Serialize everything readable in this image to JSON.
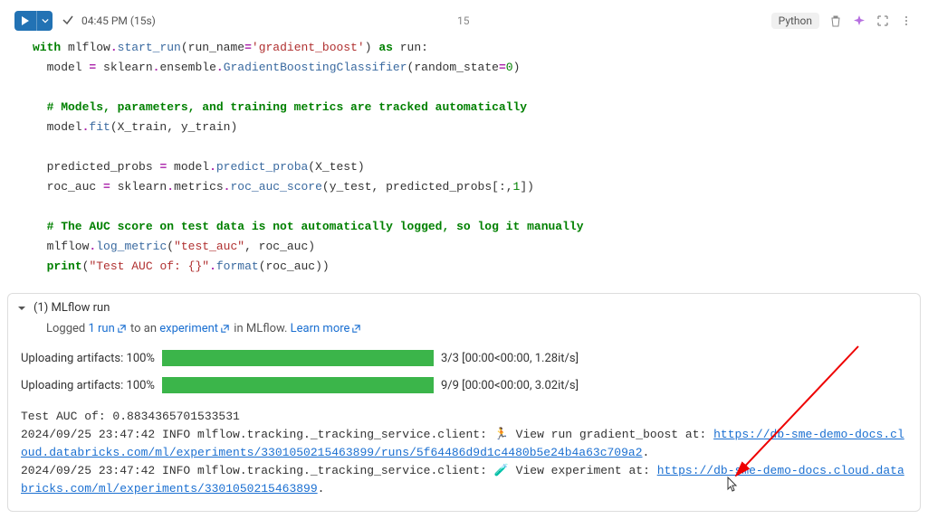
{
  "header": {
    "time": "04:45 PM (15s)",
    "cell_num": "15",
    "lang": "Python"
  },
  "code": {
    "l1a": "with",
    "l1b": " mlflow",
    "l1c": ".",
    "l1d": "start_run",
    "l1e": "(run_name",
    "l1f": "=",
    "l1g": "'gradient_boost'",
    "l1h": ") ",
    "l1i": "as",
    "l1j": " run:",
    "l2a": "  model ",
    "l2b": "=",
    "l2c": " sklearn",
    "l2d": ".",
    "l2e": "ensemble",
    "l2f": ".",
    "l2g": "GradientBoostingClassifier",
    "l2h": "(random_state",
    "l2i": "=",
    "l2j": "0",
    "l2k": ")",
    "l3": "  # Models, parameters, and training metrics are tracked automatically",
    "l4a": "  model",
    "l4b": ".",
    "l4c": "fit",
    "l4d": "(X_train, y_train)",
    "l5a": "  predicted_probs ",
    "l5b": "=",
    "l5c": " model",
    "l5d": ".",
    "l5e": "predict_proba",
    "l5f": "(X_test)",
    "l6a": "  roc_auc ",
    "l6b": "=",
    "l6c": " sklearn",
    "l6d": ".",
    "l6e": "metrics",
    "l6f": ".",
    "l6g": "roc_auc_score",
    "l6h": "(y_test, predicted_probs[:,",
    "l6i": "1",
    "l6j": "])",
    "l7": "  # The AUC score on test data is not automatically logged, so log it manually",
    "l8a": "  mlflow",
    "l8b": ".",
    "l8c": "log_metric",
    "l8d": "(",
    "l8e": "\"test_auc\"",
    "l8f": ", roc_auc)",
    "l9a": "  ",
    "l9b": "print",
    "l9c": "(",
    "l9d": "\"Test AUC of: {}\"",
    "l9e": ".",
    "l9f": "format",
    "l9g": "(roc_auc))"
  },
  "mlflow": {
    "title": "(1) MLflow run",
    "sub_prefix": "Logged ",
    "sub_link1": "1 run",
    "sub_mid1": " to an ",
    "sub_link2": "experiment",
    "sub_mid2": " in MLflow. ",
    "sub_link3": "Learn more"
  },
  "bars": [
    {
      "label": "Uploading artifacts: 100%",
      "stats": "3/3 [00:00<00:00, 1.28it/s]"
    },
    {
      "label": "Uploading artifacts: 100%",
      "stats": "9/9 [00:00<00:00, 3.02it/s]"
    }
  ],
  "console": {
    "l1": "Test AUC of: 0.8834365701533531",
    "l2a": "2024/09/25 23:47:42 INFO mlflow.tracking._tracking_service.client: 🏃 View run gradient_boost at: ",
    "l2url": "https://db-sme-demo-docs.cloud.databricks.com/ml/experiments/3301050215463899/runs/5f64486d9d1c4480b5e24b4a63c709a2",
    "l2b": ".",
    "l3a": "2024/09/25 23:47:42 INFO mlflow.tracking._tracking_service.client: 🧪 View experiment at: ",
    "l3url": "https://db-sme-demo-docs.cloud.databricks.com/ml/experiments/3301050215463899",
    "l3b": "."
  }
}
